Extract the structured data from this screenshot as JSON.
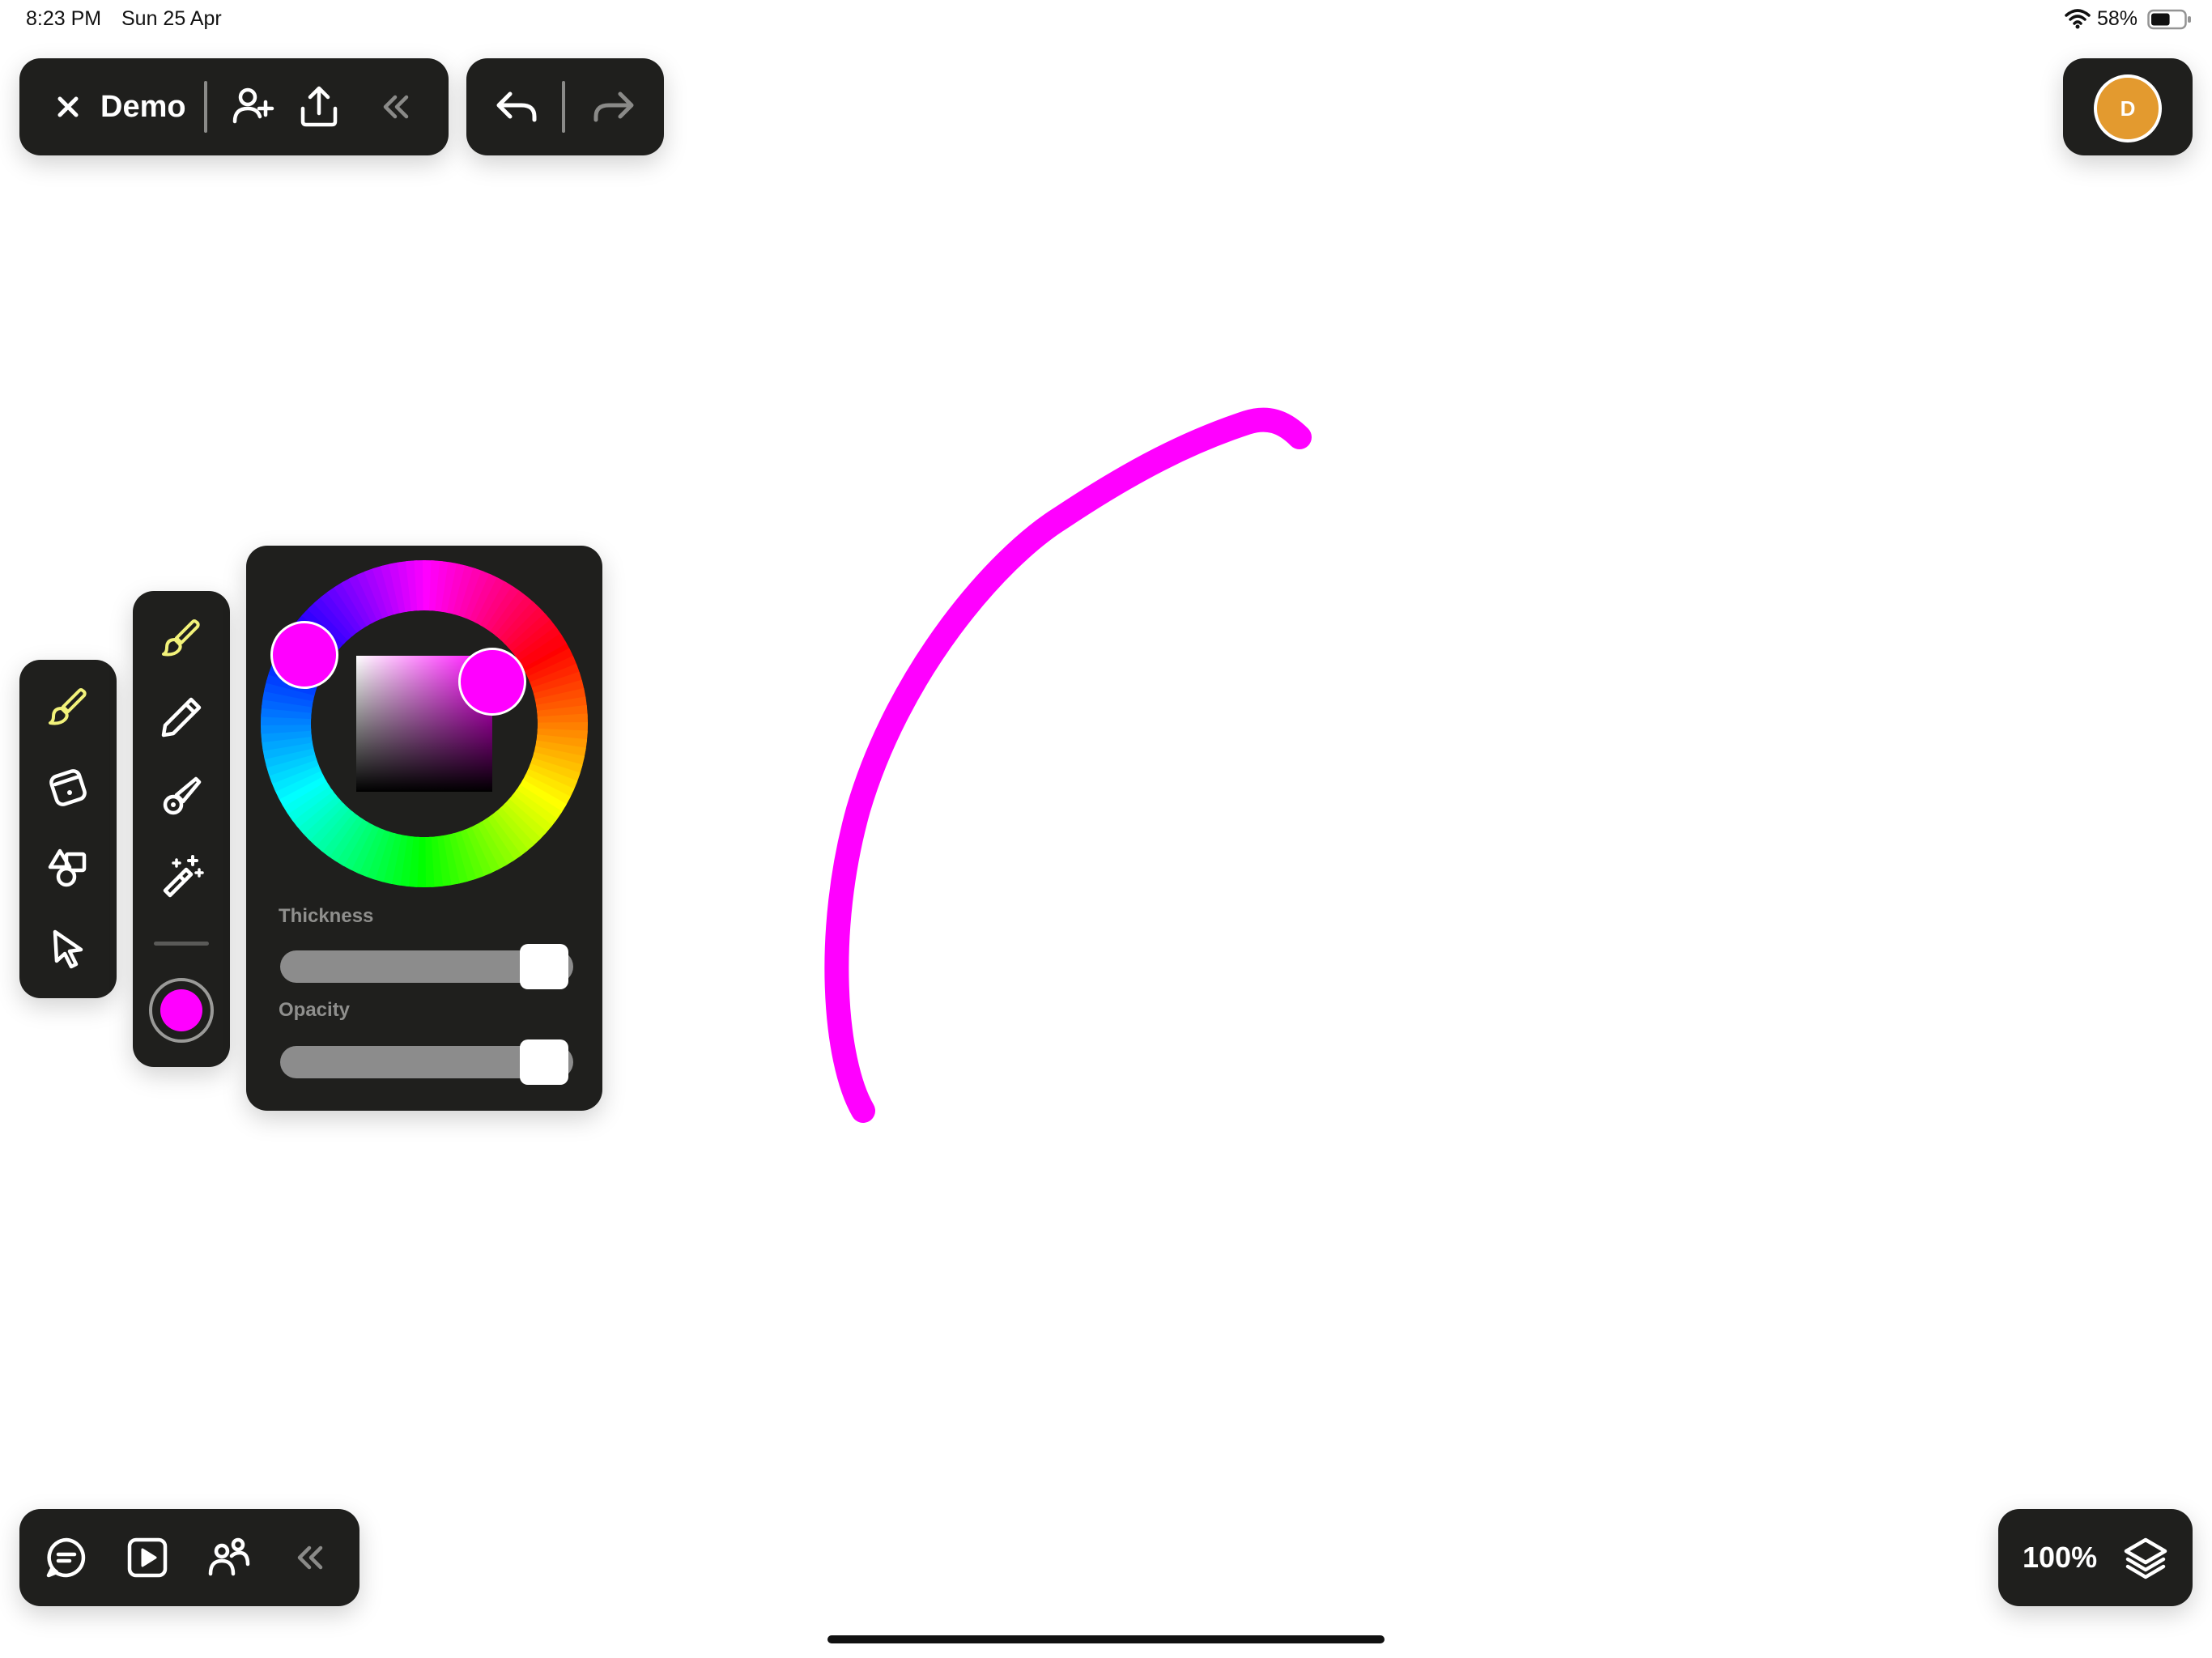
{
  "status_bar": {
    "time": "8:23 PM",
    "date": "Sun 25 Apr",
    "battery_percent": "58%",
    "battery_level": 0.58
  },
  "toolbar": {
    "close_icon": "close-icon",
    "document_title": "Demo",
    "add_user_icon": "add-user-icon",
    "share_icon": "share-icon",
    "collapse_icon": "chevron-double-left-icon",
    "undo_icon": "undo-icon",
    "redo_icon": "redo-icon"
  },
  "profile": {
    "avatar_initial": "D",
    "avatar_color": "#e39a2f"
  },
  "tools": {
    "items": [
      {
        "name": "brush-tool",
        "icon": "brush-icon",
        "active": true
      },
      {
        "name": "eraser-tool",
        "icon": "eraser-icon",
        "active": false
      },
      {
        "name": "shapes-tool",
        "icon": "shapes-icon",
        "active": false
      },
      {
        "name": "select-tool",
        "icon": "cursor-icon",
        "active": false
      }
    ],
    "active_color": "#f2f27a"
  },
  "brushes": {
    "items": [
      {
        "name": "paint-brush",
        "icon": "paint-brush-icon",
        "active": true
      },
      {
        "name": "pencil",
        "icon": "pencil-icon",
        "active": false
      },
      {
        "name": "marker",
        "icon": "marker-icon",
        "active": false
      },
      {
        "name": "magic-wand",
        "icon": "magic-wand-icon",
        "active": false
      }
    ],
    "current_color": "#ff00ff"
  },
  "color_picker": {
    "selected_color": "#ff00ff",
    "hue_degrees": 300,
    "thickness_label": "Thickness",
    "thickness_value": 0.9,
    "opacity_label": "Opacity",
    "opacity_value": 0.9
  },
  "canvas": {
    "stroke_color": "#ff00ff"
  },
  "bottom_toolbar": {
    "comments_icon": "comment-icon",
    "present_icon": "play-icon",
    "collaborators_icon": "people-icon",
    "collapse_icon": "chevron-double-left-icon"
  },
  "zoom": {
    "label": "100%",
    "layers_icon": "layers-icon"
  }
}
